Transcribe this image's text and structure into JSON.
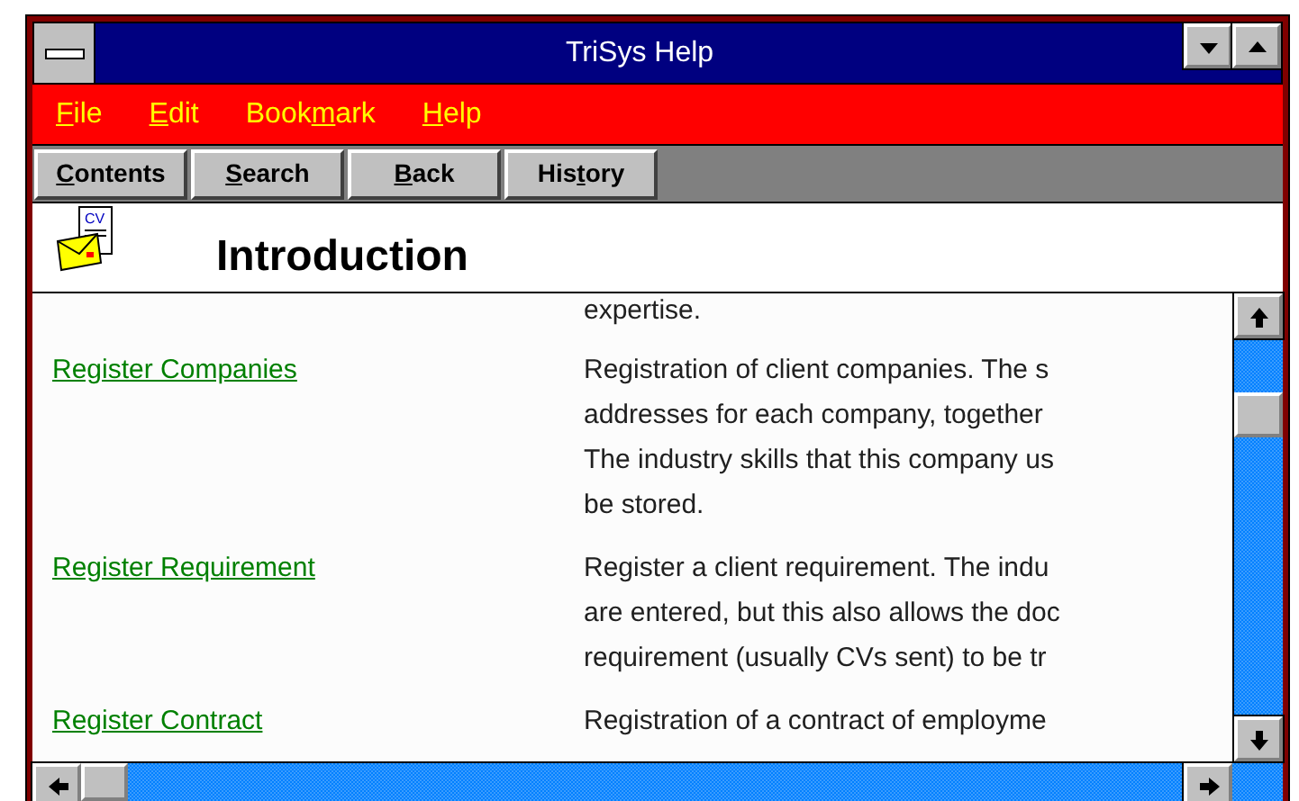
{
  "window": {
    "title": "TriSys Help"
  },
  "menu": [
    {
      "key": "F",
      "post": "ile"
    },
    {
      "key": "E",
      "post": "dit"
    },
    {
      "pre": "Book",
      "key": "m",
      "post": "ark"
    },
    {
      "key": "H",
      "post": "elp"
    }
  ],
  "buttons": [
    {
      "key": "C",
      "post": "ontents"
    },
    {
      "key": "S",
      "post": "earch"
    },
    {
      "key": "B",
      "post": "ack"
    },
    {
      "pre": "His",
      "key": "t",
      "post": "ory"
    }
  ],
  "topic": {
    "title": "Introduction",
    "icon_text": "CV"
  },
  "partial_line": "expertise.",
  "rows": [
    {
      "link": "Register Companies",
      "lines": [
        "Registration of client companies. The s",
        "addresses for each company, together",
        "The industry skills that this company us",
        "be stored."
      ]
    },
    {
      "link": "Register Requirement",
      "lines": [
        "Register a client requirement. The indu",
        "are entered, but this also allows the doc",
        "requirement (usually CVs sent) to be tr"
      ]
    },
    {
      "link": "Register Contract",
      "lines": [
        "Registration of a contract of employme"
      ]
    }
  ]
}
